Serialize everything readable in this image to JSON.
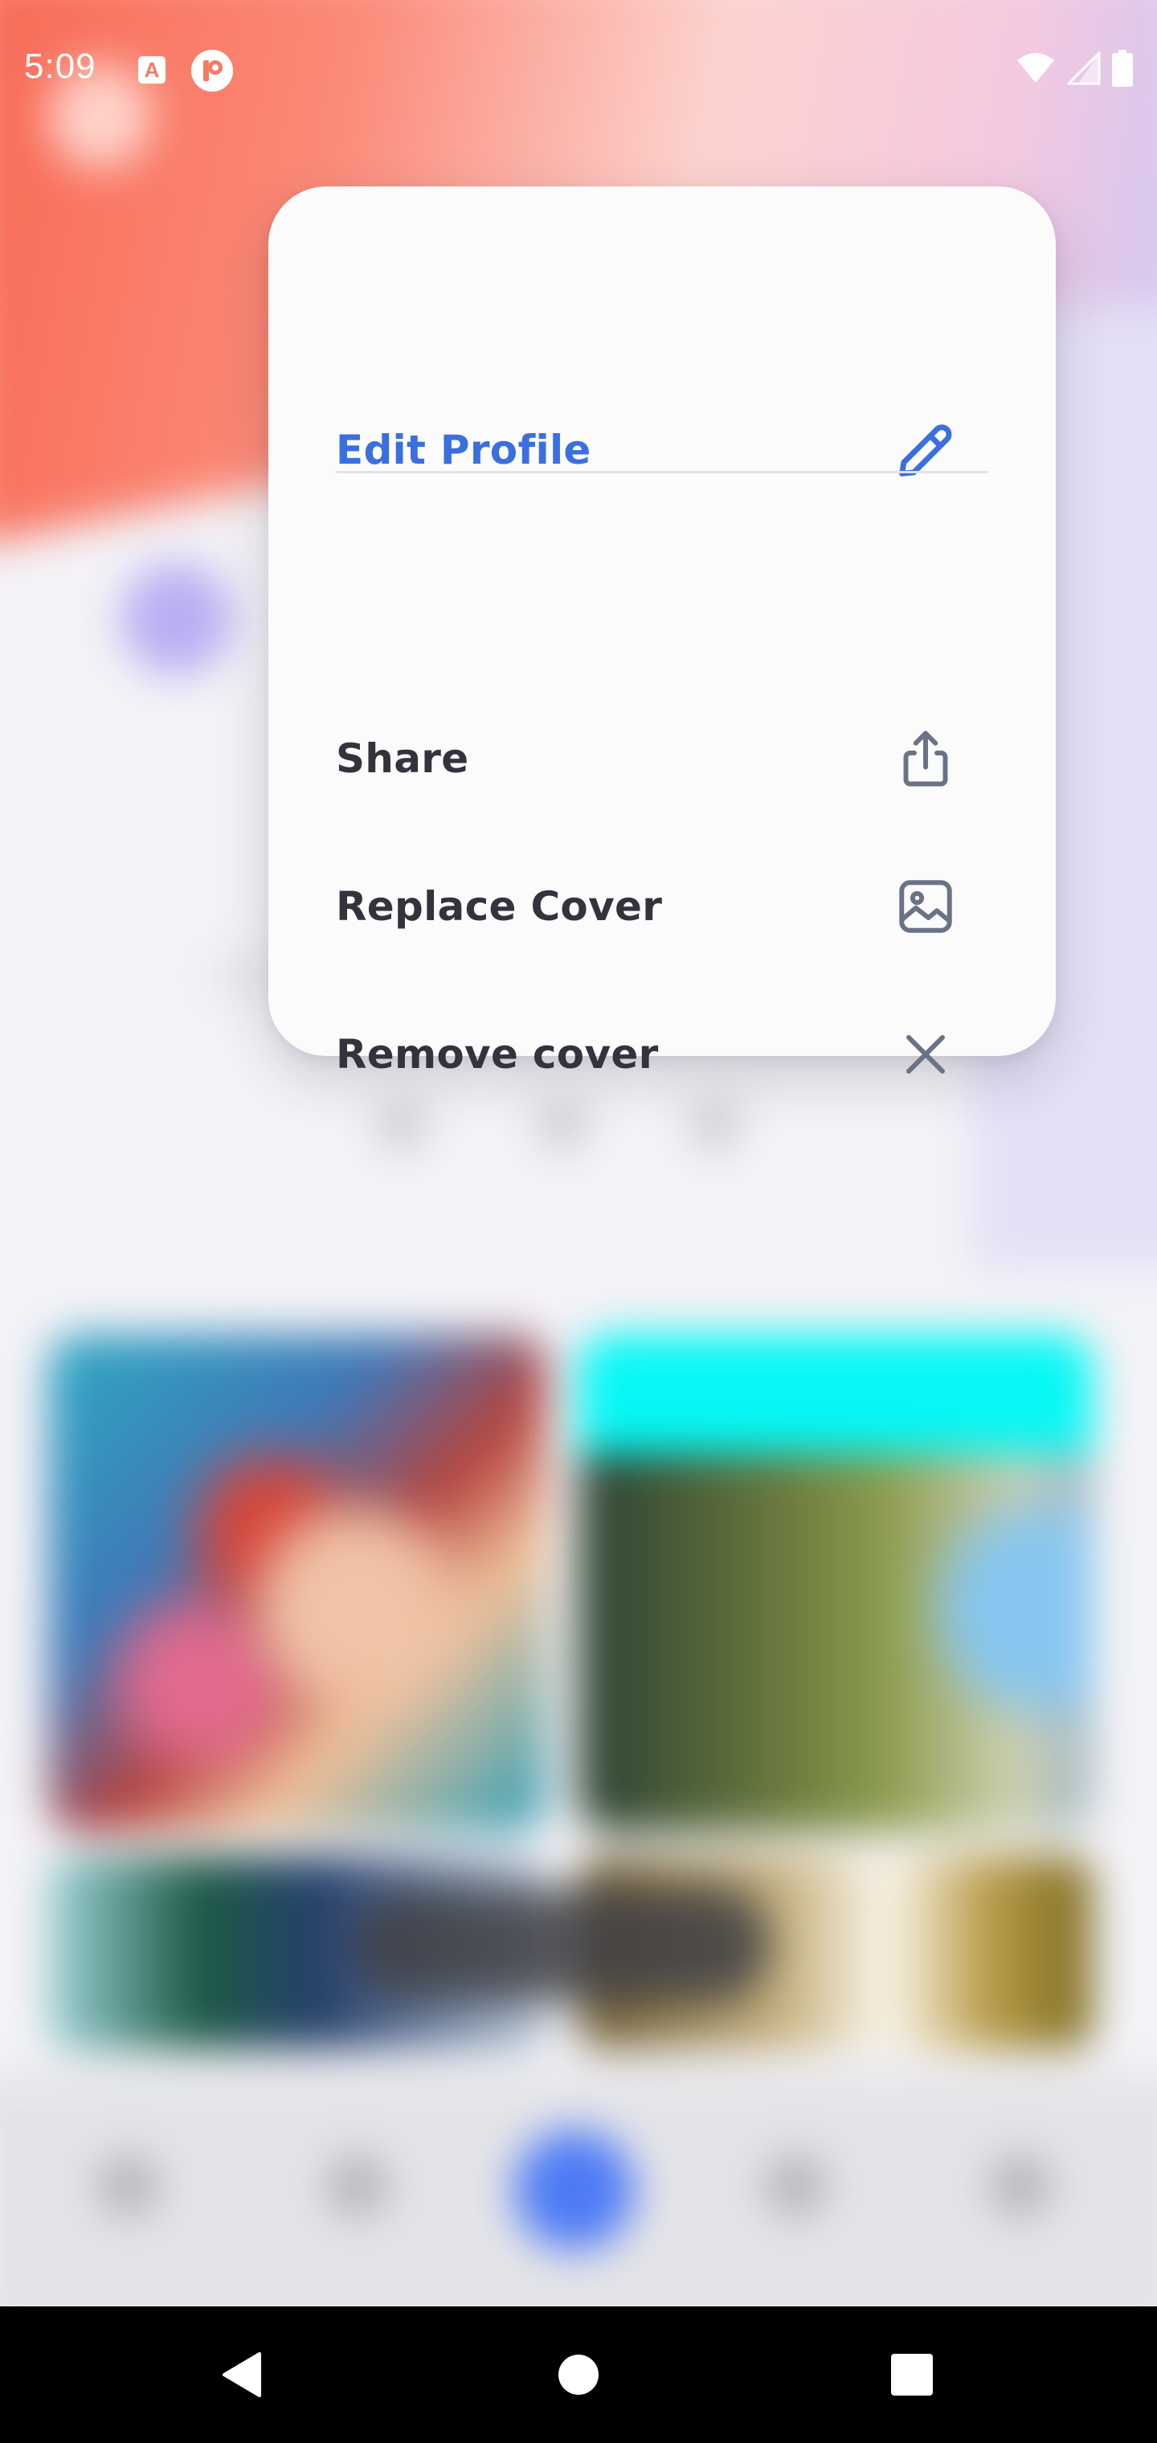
{
  "status_bar": {
    "time": "5:09",
    "notification_icons": [
      "text-a-icon",
      "p-app-icon"
    ],
    "system_icons": [
      "wifi-icon",
      "cell-signal-icon",
      "battery-icon"
    ]
  },
  "menu": {
    "items": [
      {
        "label": "Edit Profile",
        "icon": "pencil-icon",
        "accent": "#3a6fe0"
      },
      {
        "label": "Share",
        "icon": "share-icon"
      },
      {
        "label": "Replace Cover",
        "icon": "image-icon"
      },
      {
        "label": "Remove cover",
        "icon": "close-icon"
      }
    ]
  },
  "system_nav": {
    "buttons": [
      "back-icon",
      "home-icon",
      "recents-icon"
    ]
  },
  "colors": {
    "accent": "#3a6fe0",
    "menu_text": "#34333d",
    "menu_icon": "#6a7386",
    "fab": "#4d7bf5"
  }
}
